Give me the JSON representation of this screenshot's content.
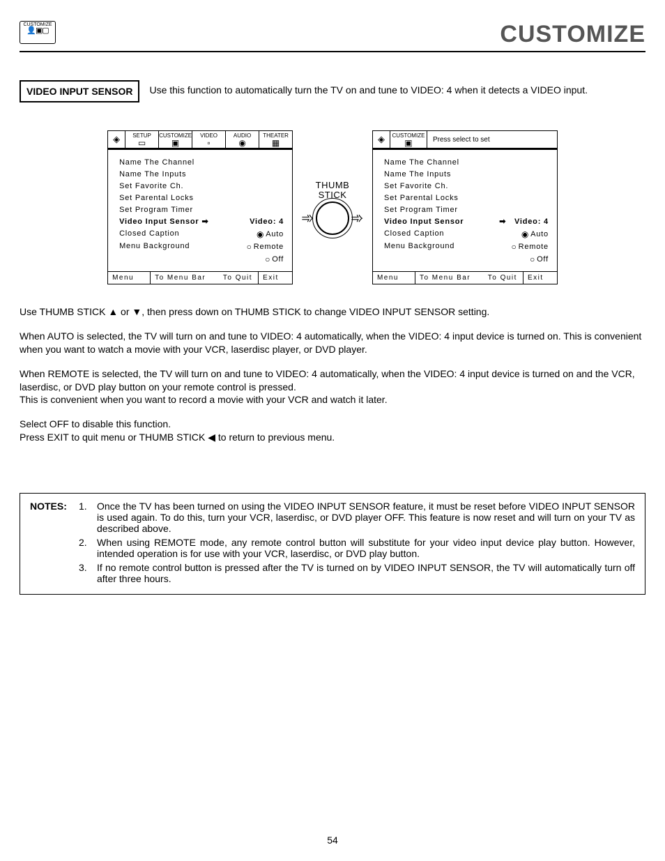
{
  "header": {
    "icon_label": "CUSTOMIZE",
    "title": "CUSTOMIZE"
  },
  "section": {
    "label": "VIDEO INPUT SENSOR",
    "desc": "Use this function to automatically turn the TV on and tune to VIDEO: 4 when it detects a VIDEO input."
  },
  "screenA": {
    "tabs": [
      "SETUP",
      "CUSTOMIZE",
      "VIDEO",
      "AUDIO",
      "THEATER"
    ],
    "items": [
      "Name The Channel",
      "Name The Inputs",
      "Set Favorite Ch.",
      "Set Parental Locks",
      "Set Program Timer",
      "Video Input Sensor",
      "Closed Caption",
      "Menu Background"
    ],
    "sel_value": "Video: 4",
    "radios": [
      "Auto",
      "Remote",
      "Off"
    ],
    "footer": {
      "menu": "Menu",
      "tomenu": "To Menu Bar",
      "toquit": "To Quit",
      "exit": "Exit"
    }
  },
  "thumbstick": {
    "line1": "THUMB",
    "line2": "STICK"
  },
  "screenB": {
    "tab": "CUSTOMIZE",
    "press": "Press select to set",
    "items": [
      "Name The Channel",
      "Name The Inputs",
      "Set Favorite Ch.",
      "Set Parental Locks",
      "Set Program Timer",
      "Video Input Sensor",
      "Closed Caption",
      "Menu Background"
    ],
    "sel_value": "Video: 4",
    "radios": [
      "Auto",
      "Remote",
      "Off"
    ],
    "footer": {
      "menu": "Menu",
      "tomenu": "To Menu Bar",
      "toquit": "To Quit",
      "exit": "Exit"
    }
  },
  "body": {
    "p1": "Use THUMB STICK ▲ or ▼, then press down on THUMB STICK to change VIDEO INPUT SENSOR setting.",
    "p2": "When AUTO is selected, the TV will turn on and tune to VIDEO: 4 automatically, when the VIDEO: 4 input device is turned on. This is convenient when you want to watch a movie with your VCR, laserdisc player, or DVD player.",
    "p3": "When REMOTE is selected, the TV will turn on and tune to VIDEO: 4 automatically, when the VIDEO: 4 input device is turned on and the VCR, laserdisc, or DVD play button on your remote control is pressed.\nThis is convenient when you want to record a movie with your VCR and watch it later.",
    "p4": "Select OFF to disable this function.\nPress EXIT to quit menu or THUMB STICK ◀ to return to previous menu."
  },
  "notes": {
    "label": "NOTES:",
    "items": [
      "Once the TV has been turned on using the VIDEO INPUT SENSOR feature, it must be reset before VIDEO INPUT SENSOR is used again. To do this, turn your VCR, laserdisc, or DVD player OFF. This feature is now reset and will turn on your TV as described above.",
      "When using REMOTE mode, any remote control button will substitute for your video input device play button. However, intended operation is for use with your VCR, laserdisc, or DVD play button.",
      "If no remote control button is pressed after the TV is turned on by VIDEO INPUT SENSOR, the TV will automatically turn off after three hours."
    ]
  },
  "page_number": "54"
}
